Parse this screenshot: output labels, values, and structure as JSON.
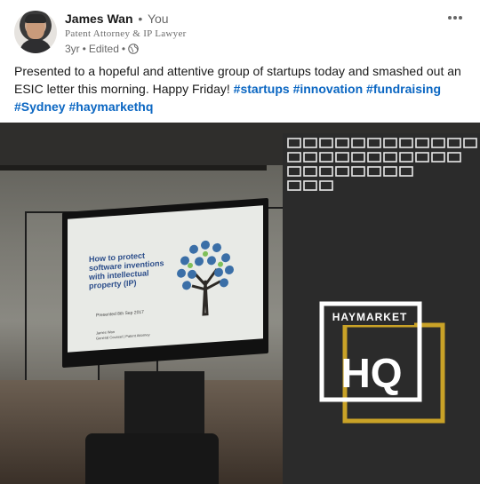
{
  "post": {
    "author": {
      "name": "James Wan",
      "relation": "You",
      "separator": "•",
      "headline": "Patent Attorney & IP Lawyer",
      "time": "3yr",
      "edited": "Edited",
      "visibility_icon": "globe-icon"
    },
    "menu_icon": "more-icon",
    "text": "Presented to a hopeful and attentive group of startups today and smashed out an ESIC letter this morning. Happy Friday! ",
    "hashtags": [
      "#startups",
      "#innovation",
      "#fundraising",
      "#Sydney",
      "#haymarkethq"
    ]
  },
  "photo": {
    "slide": {
      "title": "How to protect software inventions with intellectual property (IP)",
      "subtitle": "Presented 8th Sep 2017",
      "footer_1": "James Wan",
      "footer_2": "General Counsel | Patent Attorney"
    },
    "banner": {
      "brand_top": "HAYMARKET",
      "brand_bottom": "HQ",
      "accent_color": "#c9a227"
    }
  },
  "colors": {
    "link": "#0a66c2",
    "text": "#000000e6",
    "muted": "#00000099"
  }
}
